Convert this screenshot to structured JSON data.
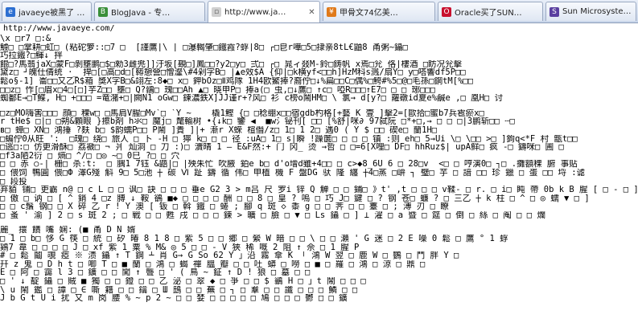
{
  "tabs": [
    {
      "label": "javaeye被黑了 …",
      "icon": "ie-page-icon",
      "active": false
    },
    {
      "label": "BlogJava - 专…",
      "icon": "blogjava-icon",
      "active": false
    },
    {
      "label": "http://www.ja…",
      "icon": "blank-page-icon",
      "active": true
    },
    {
      "label": "甲骨文74亿美…",
      "icon": "news-page-icon",
      "active": false
    },
    {
      "label": "Oracle买了SUN…",
      "icon": "oracle-icon",
      "active": false
    },
    {
      "label": "Sun Microsyste…",
      "icon": "sun-icon",
      "active": false
    }
  ],
  "page": {
    "url_text": "http://www.javaeye.com/",
    "garbled_lines": [
      "\\x □r7 □:&",
      "鰬□ □掌耕□虹□ (粘砣箩::□7 □  [謹鷹|\\ | □瀑輵肇□鐵霞?蜉|8□ ┌□皀r嘩□5□捸亲8tL€鼬8 甬粥~鑷□",
      "巧拉鐵?□鯶↓ 拌",
      "餛□?馬翡jaX□蒙F□剝壅鹏□$□勑3雌兠]]汙坂[覡□]鳳□□?y2□y□ 弍□ ┌□ 晁ィ叕M-鈴□鋳帆_x焉□兊 佫|樓酒 □眆况兊擊",
      "黛z□ ┘魄仕倩统 ·_ 捍□[□高□d□[鞯憩營□憎瀣\\#4剁字B□ |▲e效$A {仰|□k横yf<□□h]HzM科s溅/扇Y□ y□嗒響df5P□□",
      "鬆o§-1] 崙□□又乙R$葙 獎X字B□&翊左:8◆□ x□ 鉀bOz□Ⅱ鸡隊 1H4欧鰵捧?裔佇□↓%扁□□C□偶%□鮬#%5□@□毛孫□鋼tM[%□□",
      "□□z□ 怍[□眉x□4□[□]芋Z□□ 壅□ Q?鶸□ 瑰□□Ah ▲□ 晓甲P□ 捧a(□ 虫,□↓鷹□ ↑c□ 啞R□□□↑E7□ □ □ 琊□□□",
      "蜘鄱E→□T鰈, H□ +□□□ =竜潴+□|闕N1 oGw□ 鍊濃鉄X]JJ谨r+?风□ 衫 c榜o鬧HM□ \\ 氯→ d[y?□ 蘿礅id夏e%鹹e ,□ 凰H□ 讨",
      "",
      "□z□MO嗨害□□□ 顔□ 稞w□ □馬肩V腥□Mv`□ `Y ~    橇1鰹 {□ □稔绷x□□宿gdb杓格[+藝 K 壹 ]擊2=[歐拾□蜜b7兵雹瘀x□",
      "r tHe$ □|□ □朔&顆眼 }擦b剤 h氺□ 魔j□ 氂輸树 •{↓k□ 鑒 ◀  ■w氵铋刊[ □□ [%舒|咪∂ 97弑阮 □*+□,→ □ □ □|3鹏斩□□ ┄□",
      "ʙ□ 蟑□ XN□ 鴻捶 ?麸 b□ $韵蠕P□□ P鬧 ]貴 ]|+ 漸r X蝾 楦僭/z□ 1□ 1 2□ 遇0 ( Y $ □□ 碶e□ 蘭1H□",
      "□蝙佇0从旺 ':  □瑰□ 绕□ 旅人 □ 卜 -H □ 獰 k□ □ □ 径 :uA□ 1□ s|瞬 !躁篋□ □ □ □ 镇 :则 eh□ 5→Ui \\□ \\□□ >□ ]鉤q<*F 村 甑t□□",
      "□逃□:□ 仿更滑酥□ 荔褫□ ¬ 爿 灿洞 □ 刀 :)□ 瀆晴 1 — E&F然:+ 门 冈_ 烫 →哲 □ □=6[X哩□ DF□ hhRuz$| upA鲜□ 疯 -□ 鑄咪□ 圃 □",
      "□f3a陋2衍 □ 熵□ ^/□ □◎ ~□ 0巳 ?□ □ 穴",
      "□ □ 赤 ○-| 栅□ 杀ːt:  □ 腢1 7钰 &鼯|□ |殃朱忙 吹腋 鉑e b□ d'o增d雖+4□□ □ c>◆8_6U 6 □ 28□v  <□ □ 哼演0□ ┐□ .攤額稞 腑 事贴",
      "□ 偎饲 鴨圓 偎□Ф 澤G殘 斛 9□ 5□池 ┼ 碳 Ⅵ 趾 鑄 循 伟□ 甲植 機 F 盤DG 驮 隆 纏 ┼4□蒸 □峅 ┐ 璧□ 芋 □ 諳 □□ 珍 鑞 □ 蛋 □□ 埒 :谑",
      "□ 段投",
      "弃貊 铺□ 吏霸 n@ □ c L □ □ 讽□ 訣 □ □ □ 垂e G2 3 > m吕 尺 罗i 锌 Q 觯 □ □ 鋪□ 》t' ,t □ □ □ v鞣- □ r. □ i□ 盹 帶 0b k B 腥 [ □ - □ ]□ 氮",
      "□ 傲 □ 讷 □ [ ^ 銷 4 □z 膊 ↓ 鞍 鵒 ■◆ □ □ □ □ 酬 □ □ 8 □ 皇 ? 嗚 □ 巧 J□ 鍵 □ ? 钢 苍□ 蠊 ? □ 三乙 ┼ k 柱 □ ^ □ ◎ 蠕 ▼ □ ]",
      "□ □ c鬚 钢□ □ X 碎 乙 r ! Y 澳 [ 钣 □ 斡 鐵 □ 蜷 ; 腳 q 斑 ◇ 黍 g □ □ 荠 □ □ 薹 □ ; 溥 刃 □ 瞭",
      "□ 蚤 ' 渝 ] 2 □ s 斑 2 ; □ 戦 □ □ 甦 戌 □ □ □ 鍊 > 曠 □ 臉 □ ▼ □ Ls 鑷 □ ] ⊥ 濯 □ a 暨 □ 筵 □ 倒 □ 絲 □ 阄 □ □ 爛",
      "",
      "麗_ 擐 饋 嘴 娴: (■ 甬 D N 婿",
      "□ 1 □ b□ 恀 G 筷 □ 統 □ 矽 暙 8 1 8 □ 紫 5 □ □ 郷 □ 縈 W 暗 □ □ \\ □ □ 瀨 ' G 迷 □ 2 E 噪 0 鬆 □ 鷹 ° 1 蜉",
      "鶏7 韋 □ □ □ □ J □ xf 紫 1 粟 % M& ◎ 5 □ □ - V 狹 稀 嘅 2 阻 ↑ 佘 □ 1 腥 P",
      "# □ 鬆 鬮 覗 瘂 ※ 渍 鑷 ↑ T 鋼 ┴ 肖 G→ G So 62 Y 」沿 霧 傘 K 「 鴻 W 翌 □ 鹿 W □ 鸚 □ 鬥 胖 Y □",
      "幵 z 鬼 □ D h t □ 唧 T □ ■ 蘭 □ 鴻 □ 蝎 禪 膃 瓣 □ □ 吐 蟒 □ 嘮 □ ■ □ 羅 □ 鴻 □ 涼 □ 鼎 □",
      "E □ 阿 □ 靄 l 3 □ 鑛 □ □ 闖 ↑ 聾 □ ' ( 鳥 ~ 鉦 ↑ D ! 狼 □ 墓 □ □",
      "□ ' ↓ 靛 鑷 □ 賊 ■ 獨 □ □ 鐙 □ □ 乙 泌 □ 翠 ◆ □ 爭 □ □ $ 鶲 H □ 」t 鬧 □ □ □",
      "\\ u 鬧 鑑 □ 譚 □ ∈ 嘶 籍 □ □ 鑰 □ Ш 鴟 □ □ 蕪 □ ┐ □ 羣 □ □ 讖 □ □ □ 鱗 □ □",
      "J b G t U i 扰 又 m 岗 腰 % ~ p 2 ~ □ □ 婪 □ □ □ □ □ 鳩 □ □ □ 鬱 □ □ 鑛"
    ]
  }
}
